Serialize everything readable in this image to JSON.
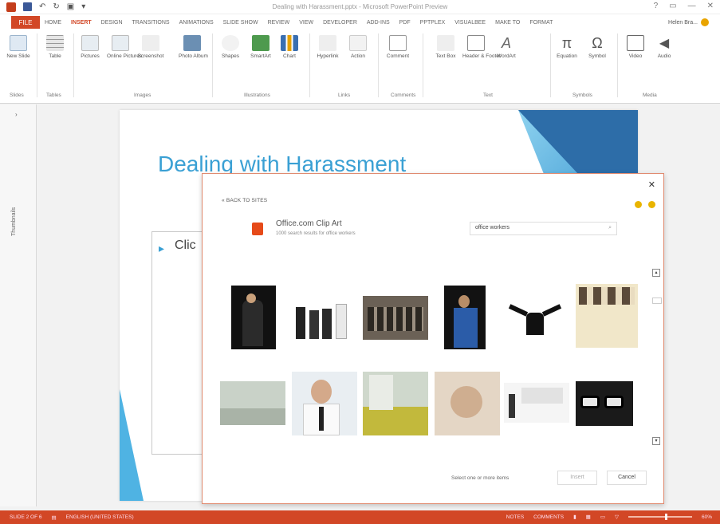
{
  "window": {
    "title": "Dealing with Harassment.pptx - Microsoft PowerPoint Preview",
    "controls": [
      "?",
      "▭",
      "—",
      "✕"
    ]
  },
  "tabs": {
    "file": "FILE",
    "items": [
      "HOME",
      "INSERT",
      "DESIGN",
      "TRANSITIONS",
      "ANIMATIONS",
      "SLIDE SHOW",
      "REVIEW",
      "VIEW",
      "DEVELOPER",
      "ADD-INS",
      "PDF",
      "PPTPLEX",
      "VISUALBEE",
      "MAKE TO",
      "FORMAT"
    ],
    "active": "INSERT",
    "user": "Helen Bra..."
  },
  "ribbon": {
    "buttons": [
      {
        "label": "New Slide",
        "icon": "new-slide-icon"
      },
      {
        "label": "Table",
        "icon": "table-icon"
      },
      {
        "label": "Pictures",
        "icon": "pictures-icon"
      },
      {
        "label": "Online Pictures",
        "icon": "online-pictures-icon"
      },
      {
        "label": "Screenshot",
        "icon": "screenshot-icon"
      },
      {
        "label": "Photo Album",
        "icon": "photo-album-icon"
      },
      {
        "label": "Shapes",
        "icon": "shapes-icon"
      },
      {
        "label": "SmartArt",
        "icon": "smartart-icon"
      },
      {
        "label": "Chart",
        "icon": "chart-icon"
      },
      {
        "label": "Hyperlink",
        "icon": "hyperlink-icon"
      },
      {
        "label": "Action",
        "icon": "action-icon"
      },
      {
        "label": "Comment",
        "icon": "comment-icon"
      },
      {
        "label": "Text Box",
        "icon": "text-box-icon"
      },
      {
        "label": "Header & Footer",
        "icon": "header-footer-icon"
      },
      {
        "label": "WordArt",
        "icon": "wordart-icon"
      },
      {
        "label": "Equation",
        "icon": "equation-icon"
      },
      {
        "label": "Symbol",
        "icon": "symbol-icon"
      },
      {
        "label": "Video",
        "icon": "video-icon"
      },
      {
        "label": "Audio",
        "icon": "audio-icon"
      }
    ],
    "groups": [
      "Slides",
      "Tables",
      "Images",
      "Illustrations",
      "Links",
      "Comments",
      "Text",
      "Symbols",
      "Media"
    ]
  },
  "thumbnails_pane": {
    "label": "Thumbnails"
  },
  "slide": {
    "title": "Dealing with Harassment",
    "placeholder_text": "Clic"
  },
  "dialog": {
    "back_link": "« BACK TO SITES",
    "source_title": "Office.com Clip Art",
    "source_subtitle": "1000 search results for office workers",
    "search_value": "office workers",
    "hint": "Select one or more items",
    "insert_label": "Insert",
    "cancel_label": "Cancel",
    "close_label": "✕"
  },
  "statusbar": {
    "slide_info": "SLIDE 2 OF 6",
    "language": "ENGLISH (UNITED STATES)",
    "notes": "NOTES",
    "comments": "COMMENTS",
    "zoom": "60%"
  },
  "colors": {
    "accent": "#d24726",
    "slide_title": "#3aa0d4",
    "slide_deco": "#2d6da8"
  }
}
